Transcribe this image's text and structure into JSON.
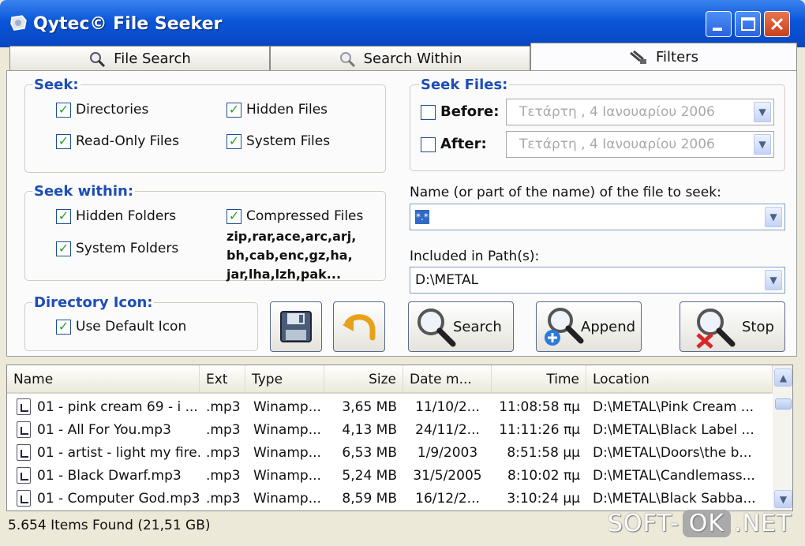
{
  "window": {
    "title": "Qytec© File Seeker"
  },
  "tabs": [
    {
      "label": "File Search",
      "icon": "magnifier-icon"
    },
    {
      "label": "Search Within",
      "icon": "magnifier-icon"
    },
    {
      "label": "Filters",
      "icon": "filter-icon"
    }
  ],
  "seek": {
    "title": "Seek:",
    "directories": "Directories",
    "hidden_files": "Hidden Files",
    "readonly_files": "Read-Only Files",
    "system_files": "System Files"
  },
  "seek_files": {
    "title": "Seek Files:",
    "before_label": "Before:",
    "after_label": "After:",
    "before_date": "Τετάρτη ,  4  Ιανουαρίου  2006",
    "after_date": "Τετάρτη ,  4  Ιανουαρίου  2006"
  },
  "seek_within": {
    "title": "Seek within:",
    "hidden_folders": "Hidden Folders",
    "system_folders": "System Folders",
    "compressed_files": "Compressed Files",
    "extensions": "zip,rar,ace,arc,arj, bh,cab,enc,gz,ha, jar,lha,lzh,pak..."
  },
  "name_field": {
    "label": "Name (or part of the name) of the file to seek:",
    "value": "*.*"
  },
  "path_field": {
    "label": "Included in Path(s):",
    "value": "D:\\METAL"
  },
  "directory_icon": {
    "title": "Directory Icon:",
    "use_default": "Use Default Icon"
  },
  "buttons": {
    "search": "Search",
    "append": "Append",
    "stop": "Stop"
  },
  "columns": [
    "Name",
    "Ext",
    "Type",
    "Size",
    "Date m...",
    "Time",
    "Location"
  ],
  "rows": [
    {
      "name": "01  - pink cream 69 - i ...",
      "ext": ".mp3",
      "type": "Winamp...",
      "size": "3,65 MB",
      "date": "11/10/2...",
      "time": "11:08:58 πμ",
      "location": "D:\\METAL\\Pink Cream ..."
    },
    {
      "name": "01 - All For You.mp3",
      "ext": ".mp3",
      "type": "Winamp...",
      "size": "4,13 MB",
      "date": "24/11/2...",
      "time": "11:11:26 πμ",
      "location": "D:\\METAL\\Black Label ..."
    },
    {
      "name": "01 - artist - light my fire....",
      "ext": ".mp3",
      "type": "Winamp...",
      "size": "6,53 MB",
      "date": "1/9/2003",
      "time": "8:51:58 μμ",
      "location": "D:\\METAL\\Doors\\the b..."
    },
    {
      "name": "01 - Black Dwarf.mp3",
      "ext": ".mp3",
      "type": "Winamp...",
      "size": "5,24 MB",
      "date": "31/5/2005",
      "time": "8:10:02 πμ",
      "location": "D:\\METAL\\Candlemass..."
    },
    {
      "name": "01 - Computer God.mp3",
      "ext": ".mp3",
      "type": "Winamp...",
      "size": "8,59 MB",
      "date": "16/12/2...",
      "time": "3:10:24 μμ",
      "location": "D:\\METAL\\Black Sabba..."
    }
  ],
  "status": "5.654 Items Found (21,51 GB)",
  "watermark": {
    "left": "SOFT-",
    "ok": "OK",
    "right": ".NET"
  },
  "colors": {
    "titlebar": "#0a56d8",
    "group_title": "#1d4eb5",
    "check": "#23a32c"
  }
}
